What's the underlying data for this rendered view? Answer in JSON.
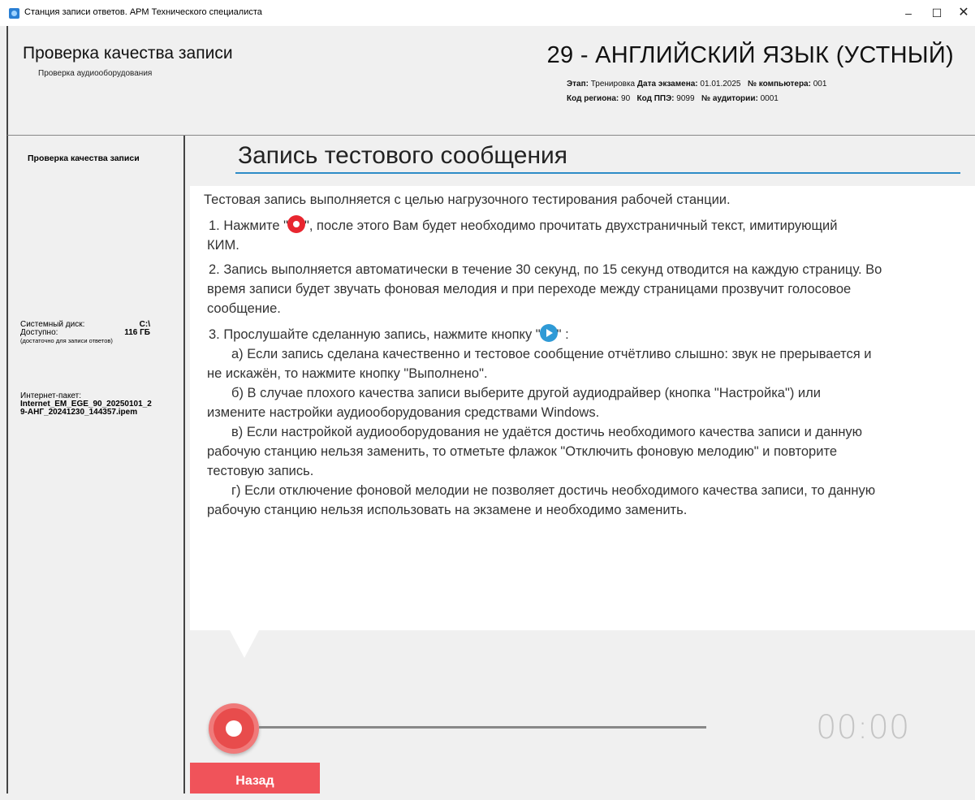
{
  "window": {
    "title": "Станция записи ответов. АРМ Технического специалиста",
    "minimize": "–",
    "maximize": "☐",
    "close": "✕"
  },
  "header": {
    "title": "Проверка качества записи",
    "subtitle": "Проверка аудиооборудования",
    "subject": "29 - АНГЛИЙСКИЙ ЯЗЫК (УСТНЫЙ)",
    "stage_label": "Этап:",
    "stage_value": "Тренировка",
    "exam_date_label": "Дата экзамена:",
    "exam_date_value": "01.01.2025",
    "computer_label": "№ компьютера:",
    "computer_value": "001",
    "region_label": "Код региона:",
    "region_value": "90",
    "ppe_label": "Код ППЭ:",
    "ppe_value": "9099",
    "room_label": "№ аудитории:",
    "room_value": "0001"
  },
  "sidebar": {
    "current_step": "Проверка качества записи",
    "disk_label": "Системный диск:",
    "disk_value": "C:\\",
    "free_label": "Доступно:",
    "free_value": "116 ГБ",
    "free_note": "(достаточно для записи ответов)",
    "package_label": "Интернет-пакет:",
    "package_line1": "Internet_EM_EGE_90_20250101_2",
    "package_line2": "9-АНГ_20241230_144357.ipem"
  },
  "main": {
    "title": "Запись тестового сообщения",
    "intro": "Тестовая запись выполняется с целью нагрузочного тестирования рабочей станции.",
    "step1_before": "1. Нажмите \"",
    "step1_after": "\", после этого Вам будет необходимо прочитать двухстраничный текст, имитирующий",
    "step1_cont": "КИМ.",
    "step2_line1": "2. Запись выполняется автоматически в течение 30 секунд, по 15 секунд отводится на каждую страницу. Во",
    "step2_line2": "время записи будет звучать фоновая мелодия и при переходе между страницами прозвучит голосовое",
    "step2_line3": "сообщение.",
    "step3_before": "3. Прослушайте сделанную запись, нажмите кнопку \"",
    "step3_after": "\" :",
    "a_line1": "а) Если запись сделана качественно и тестовое сообщение отчётливо слышно: звук не прерывается и",
    "a_line2": "не искажён, то нажмите кнопку \"Выполнено\".",
    "b_line1": "б) В случае плохого качества записи выберите другой аудиодрайвер (кнопка \"Настройка\") или",
    "b_line2": "измените настройки аудиооборудования средствами Windows.",
    "c_line1": "в) Если настройкой аудиооборудования не удаётся достичь необходимого качества записи и данную",
    "c_line2": "рабочую станцию нельзя заменить, то отметьте флажок \"Отключить фоновую мелодию\" и повторите",
    "c_line3": "тестовую запись.",
    "d_line1": "г) Если отключение фоновой мелодии не позволяет достичь необходимого качества записи, то данную",
    "d_line2": "рабочую станцию нельзя использовать на экзамене и необходимо заменить."
  },
  "player": {
    "timer": "00:00",
    "progress": 0
  },
  "footer": {
    "back_label": "Назад"
  },
  "colors": {
    "accent_blue": "#2d8cc7",
    "record_red": "#e84c4c",
    "back_button": "#f0535a",
    "play_blue": "#2f9ad6"
  },
  "icons": {
    "app": "app-icon",
    "record": "record-icon",
    "play": "play-icon"
  }
}
